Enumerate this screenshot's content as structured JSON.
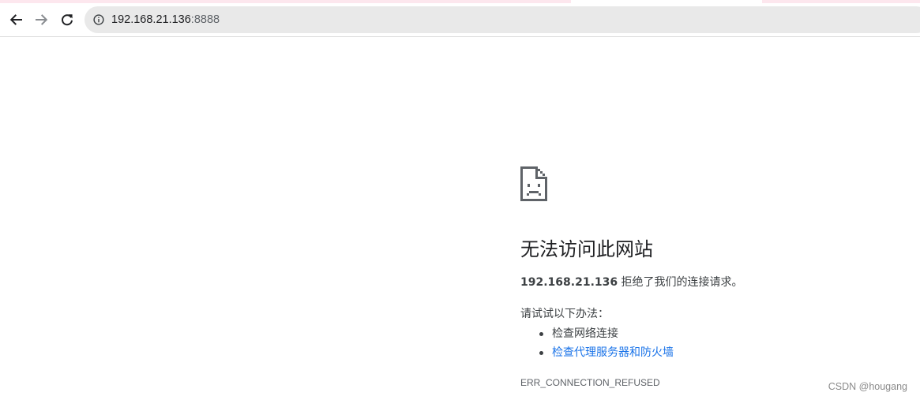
{
  "browser": {
    "address_bar": {
      "host": "192.168.21.136",
      "port": ":8888"
    },
    "icons": {
      "back": "back-arrow-icon",
      "forward": "forward-arrow-icon",
      "reload": "reload-icon",
      "site_info": "info-icon"
    }
  },
  "error_page": {
    "icon": "sad-page-icon",
    "title": "无法访问此网站",
    "summary_host": "192.168.21.136",
    "summary_text": " 拒绝了我们的连接请求。",
    "try_heading": "请试试以下办法：",
    "suggestions": [
      {
        "label": "检查网络连接",
        "is_link": false
      },
      {
        "label": "检查代理服务器和防火墙",
        "is_link": true
      }
    ],
    "error_code": "ERR_CONNECTION_REFUSED"
  },
  "watermark": "CSDN @hougang",
  "colors": {
    "link": "#1a73e8",
    "text": "#3c4043",
    "omnibox_bg": "#e9e9e9",
    "tab_strip": "#fde7ee"
  }
}
